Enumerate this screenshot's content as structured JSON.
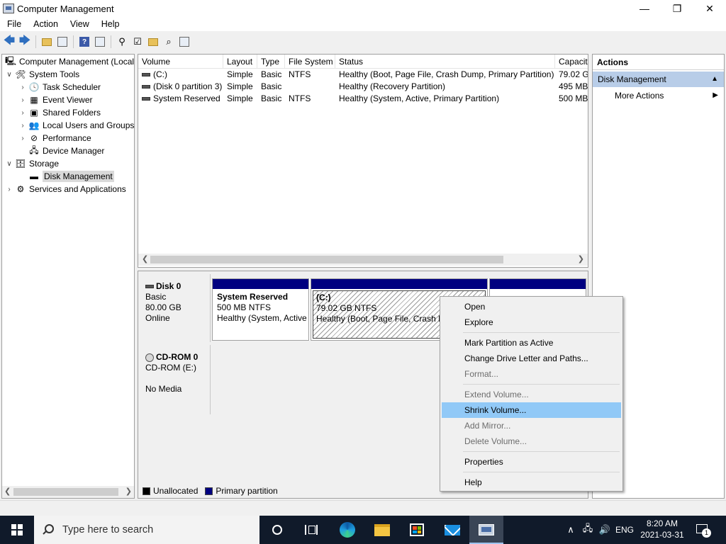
{
  "window": {
    "title": "Computer Management",
    "minimize": "—",
    "maximize": "❐",
    "close": "✕"
  },
  "menu": [
    "File",
    "Action",
    "View",
    "Help"
  ],
  "tree": {
    "root": "Computer Management (Local",
    "items": [
      {
        "label": "System Tools",
        "expander": "∨",
        "icon": "tools-icon"
      },
      {
        "label": "Task Scheduler",
        "expander": "›",
        "icon": "clock-icon"
      },
      {
        "label": "Event Viewer",
        "expander": "›",
        "icon": "event-viewer-icon"
      },
      {
        "label": "Shared Folders",
        "expander": "›",
        "icon": "shared-folder-icon"
      },
      {
        "label": "Local Users and Groups",
        "expander": "›",
        "icon": "users-icon"
      },
      {
        "label": "Performance",
        "expander": "›",
        "icon": "performance-icon"
      },
      {
        "label": "Device Manager",
        "expander": "",
        "icon": "device-manager-icon"
      },
      {
        "label": "Storage",
        "expander": "∨",
        "icon": "storage-icon"
      },
      {
        "label": "Disk Management",
        "expander": "",
        "icon": "disk-icon"
      },
      {
        "label": "Services and Applications",
        "expander": "›",
        "icon": "services-icon"
      }
    ]
  },
  "volumes": {
    "columns": [
      "Volume",
      "Layout",
      "Type",
      "File System",
      "Status",
      "Capacit"
    ],
    "rows": [
      {
        "volume": "(C:)",
        "layout": "Simple",
        "type": "Basic",
        "fs": "NTFS",
        "status": "Healthy (Boot, Page File, Crash Dump, Primary Partition)",
        "capacity": "79.02 GB"
      },
      {
        "volume": "(Disk 0 partition 3)",
        "layout": "Simple",
        "type": "Basic",
        "fs": "",
        "status": "Healthy (Recovery Partition)",
        "capacity": "495 MB"
      },
      {
        "volume": "System Reserved",
        "layout": "Simple",
        "type": "Basic",
        "fs": "NTFS",
        "status": "Healthy (System, Active, Primary Partition)",
        "capacity": "500 MB"
      }
    ]
  },
  "disks": {
    "disk0": {
      "name": "Disk 0",
      "type": "Basic",
      "size": "80.00 GB",
      "state": "Online",
      "partitions": [
        {
          "name": "System Reserved",
          "size": "500 MB NTFS",
          "status": "Healthy (System, Active"
        },
        {
          "name": "(C:)",
          "size": "79.02 GB NTFS",
          "status": "Healthy (Boot, Page File, Crash Du"
        }
      ]
    },
    "cdrom0": {
      "name": "CD-ROM 0",
      "type": "CD-ROM (E:)",
      "state": "No Media"
    },
    "legend": [
      {
        "label": "Unallocated",
        "color": "#000000"
      },
      {
        "label": "Primary partition",
        "color": "#000080"
      }
    ]
  },
  "actions": {
    "header": "Actions",
    "section": "Disk Management",
    "more": "More Actions"
  },
  "context_menu": {
    "items": [
      {
        "label": "Open",
        "enabled": true
      },
      {
        "label": "Explore",
        "enabled": true
      },
      {
        "label": "Mark Partition as Active",
        "enabled": true
      },
      {
        "label": "Change Drive Letter and Paths...",
        "enabled": true
      },
      {
        "label": "Format...",
        "enabled": false
      },
      {
        "label": "Extend Volume...",
        "enabled": false
      },
      {
        "label": "Shrink Volume...",
        "enabled": true,
        "highlighted": true
      },
      {
        "label": "Add Mirror...",
        "enabled": false
      },
      {
        "label": "Delete Volume...",
        "enabled": false
      },
      {
        "label": "Properties",
        "enabled": true
      },
      {
        "label": "Help",
        "enabled": true
      }
    ]
  },
  "taskbar": {
    "search_placeholder": "Type here to search",
    "language": "ENG",
    "time": "8:20 AM",
    "date": "2021-03-31",
    "notification_count": "1"
  },
  "colors": {
    "primary_partition": "#000080",
    "menu_highlight": "#91c9f7",
    "actions_section": "#b8cde8",
    "taskbar": "#101a2a"
  }
}
